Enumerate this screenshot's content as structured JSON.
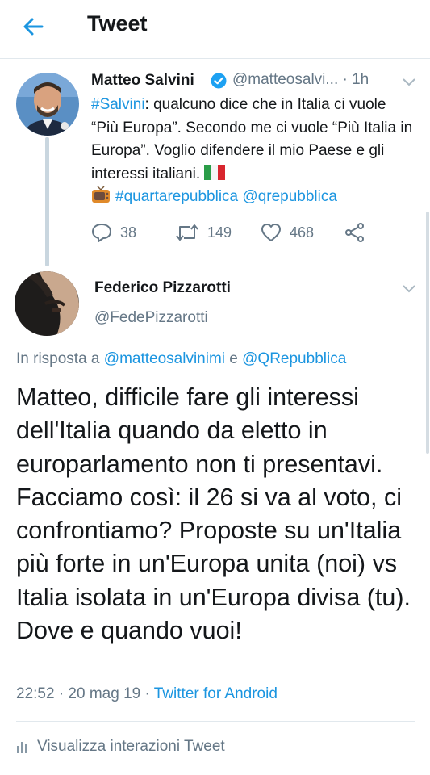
{
  "header": {
    "title": "Tweet"
  },
  "original_tweet": {
    "name": "Matteo Salvini",
    "handle": "@matteosalvi...",
    "separator": "·",
    "time": "1h",
    "hashtag": "#Salvini",
    "text_part1": ": qualcuno dice che in Italia ci vuole “Più Europa”. Secondo me ci vuole “Più Italia in Europa”. Voglio difendere il mio Paese e gli interessi italiani.",
    "hashtag2": "#quartarepubblica",
    "mention": "@qrepubblica",
    "replies": "38",
    "retweets": "149",
    "likes": "468"
  },
  "reply_tweet": {
    "name": "Federico Pizzarotti",
    "handle": "@FedePizzarotti",
    "in_reply_prefix": "In risposta a",
    "in_reply_user1": "@matteosalvinimi",
    "in_reply_and": "e",
    "in_reply_user2": "@QRepubblica",
    "text": "Matteo, difficile fare gli interessi dell'Italia quando da eletto in europarlamento non ti presentavi. Facciamo così: il 26 si va al voto, ci confrontiamo? Proposte su un'Italia più forte in un'Europa unita (noi) vs Italia isolata in un'Europa divisa (tu). Dove e quando vuoi!",
    "timestamp": "22:52 · 20 mag 19 ·",
    "source": "Twitter for Android",
    "interactions_label": "Visualizza interazioni Tweet"
  },
  "colors": {
    "link": "#1b95e0",
    "secondary": "#657786",
    "text": "#14171a"
  }
}
